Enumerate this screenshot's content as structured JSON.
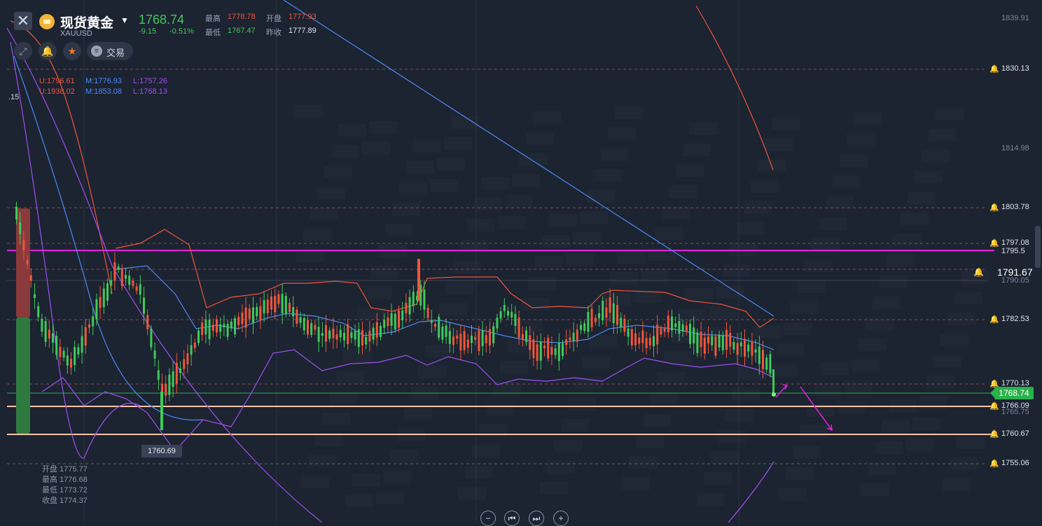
{
  "header": {
    "close_icon": "close-icon",
    "symbol_name": "现货黄金",
    "symbol_code": "XAUUSD",
    "last_price": "1768.74",
    "change": "-9.15",
    "change_pct": "-0.51%",
    "high_label": "最高",
    "high_value": "1778.78",
    "open_label": "开盘",
    "open_value": "1777.93",
    "low_label": "最低",
    "low_value": "1767.47",
    "prev_close_label": "昨收",
    "prev_close_value": "1777.89",
    "trade_label": "交易"
  },
  "indicators": {
    "row1": {
      "u": "U:1796.61",
      "m": "M:1776.93",
      "l": "L:1757.26"
    },
    "row2": {
      "u": "U:1938.02",
      "m": "M:1853.08",
      "l": "L:1768.13"
    }
  },
  "left_value": ".15",
  "price_axis": {
    "labels": [
      {
        "text": "1839.91",
        "dim": true
      },
      {
        "text": "1830.13",
        "bell": true
      },
      {
        "text": "1814.98",
        "dim": true
      },
      {
        "text": "1803.78",
        "bell": true
      },
      {
        "text": "1797.08",
        "bell": true
      },
      {
        "text": "1795.5",
        "bell": false
      },
      {
        "text": "1790.05",
        "dim": true
      },
      {
        "text": "1782.53",
        "bell": true
      },
      {
        "text": "1770.13",
        "bell": true
      },
      {
        "text": "1766.09",
        "bell": true
      },
      {
        "text": "1765.75",
        "dim": true
      },
      {
        "text": "1760.67",
        "bell": true
      },
      {
        "text": "1755.06",
        "bell": true
      }
    ],
    "current_price_tag": "1768.74",
    "marked_price": "1791.67"
  },
  "low_marker": "1760.69",
  "ohlc_tooltip": {
    "open": "开盘 1775.77",
    "high": "最高 1776.68",
    "low": "最低 1773.72",
    "close": "收盘 1774.37"
  },
  "nav_buttons": [
    "−",
    "⏮",
    "⏭",
    "+"
  ],
  "colors": {
    "up": "#f0563a",
    "down": "#3fca5a",
    "upper_band": "#f0563a",
    "mid_band": "#4a8cf5",
    "lower_band": "#a050f0",
    "magenta_line": "#e020e0",
    "support_line": "#f5c6a8"
  }
}
